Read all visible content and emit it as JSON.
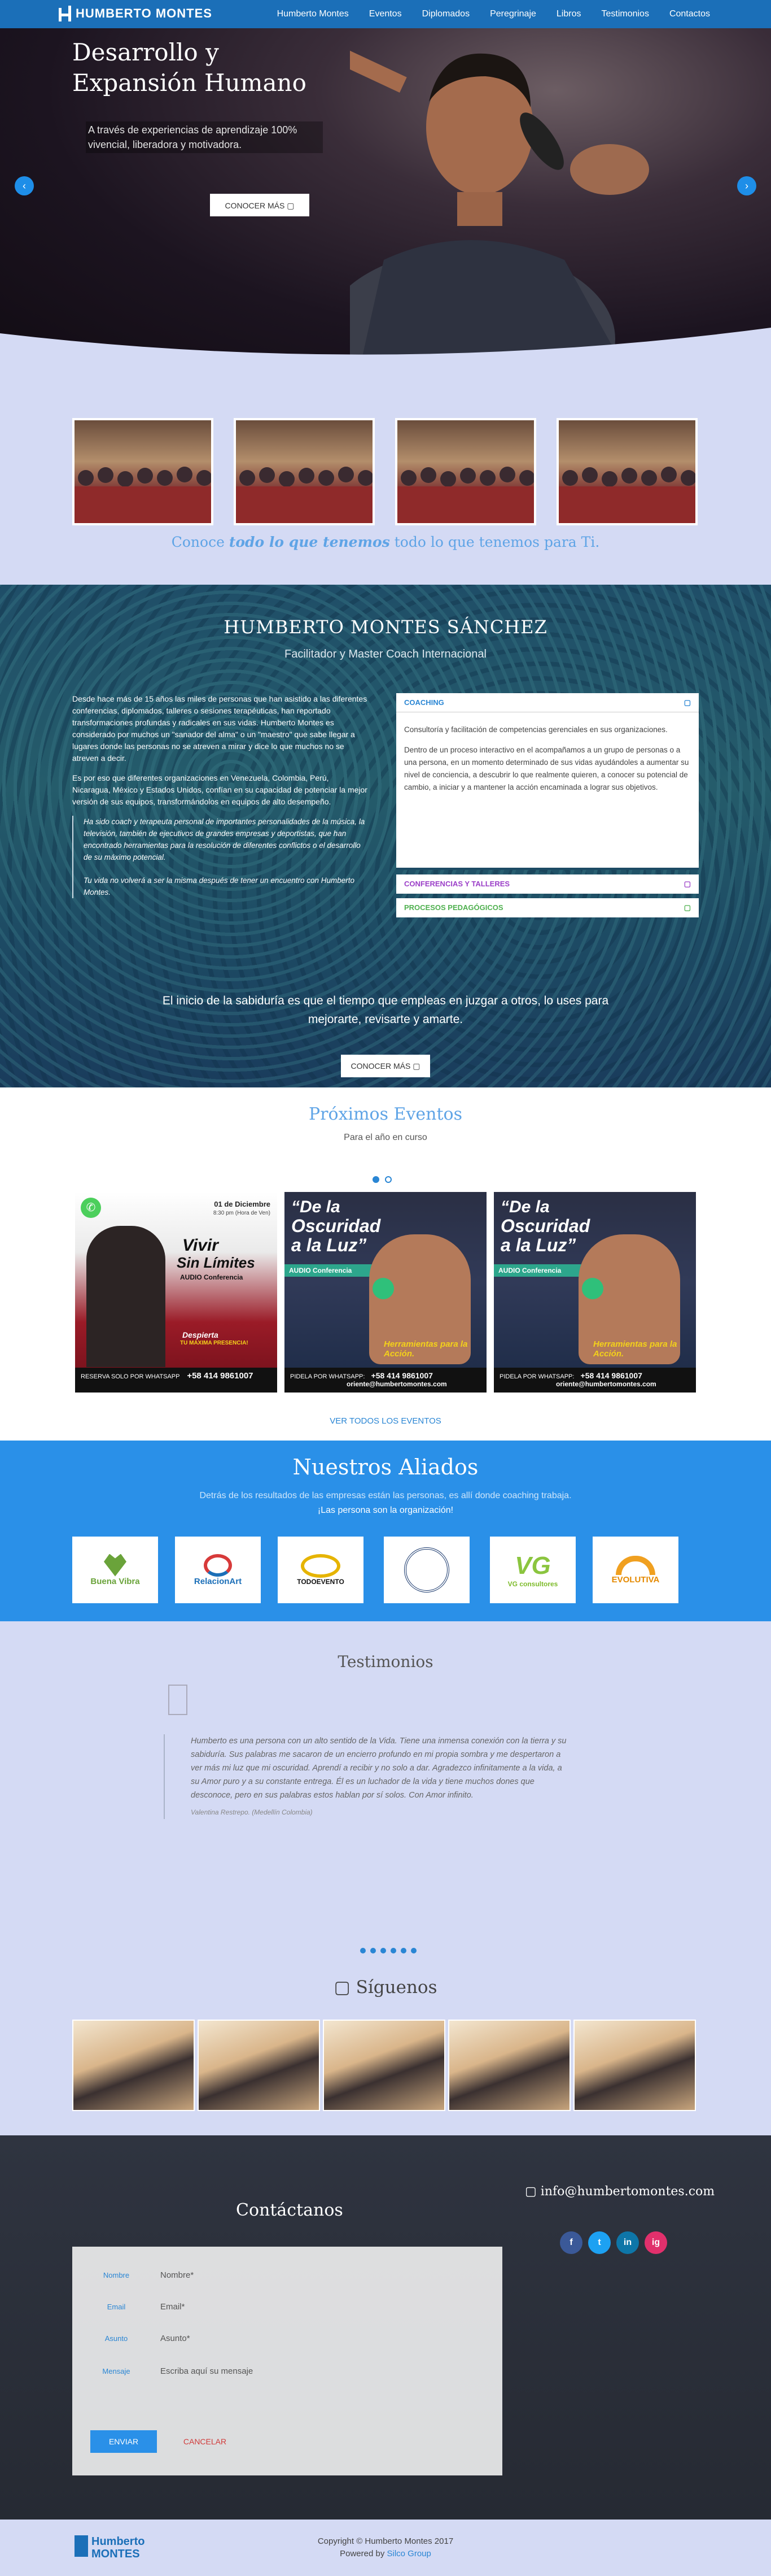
{
  "brand": {
    "name": "HUMBERTO MONTES",
    "footer_line1": "Humberto",
    "footer_line2": "MONTES"
  },
  "nav": [
    "Humberto Montes",
    "Eventos",
    "Diplomados",
    "Peregrinaje",
    "Libros",
    "Testimonios",
    "Contactos"
  ],
  "hero": {
    "title_line1": "Desarrollo y",
    "title_line2": "Expansión Humano",
    "subtitle": "A través de experiencias de aprendizaje 100% vivencial, liberadora y motivadora.",
    "cta": "CONOCER MÁS",
    "prev_icon": "‹",
    "next_icon": "›"
  },
  "gallery": {
    "caption_pre": "Conoce ",
    "caption_em": "todo lo que tenemos",
    "caption_post": " todo lo que tenemos para Ti."
  },
  "about": {
    "title": "HUMBERTO MONTES SÁNCHEZ",
    "subtitle": "Facilitador y Master Coach Internacional",
    "p1": "Desde hace más de 15 años las miles de personas que han asistido a las diferentes conferencias, diplomados, talleres o sesiones terapéuticas, han reportado transformaciones profundas y radicales en sus vidas. Humberto Montes es considerado por muchos un \"sanador del alma\" o un \"maestro\" que sabe llegar a lugares donde las personas no se atreven a mirar y dice lo que muchos no se atreven a decir.",
    "p2": "Es por eso que diferentes organizaciones en Venezuela, Colombia, Perú, Nicaragua, México y Estados Unidos, confían en su capacidad de potenciar la mejor versión de sus equipos, transformándolos en equipos de alto desempeño.",
    "q1": "Ha sido coach y terapeuta personal de importantes personalidades de la música, la televisión, también de ejecutivos de grandes empresas y deportistas, que han encontrado herramientas para la resolución de diferentes conflictos o el desarrollo de su máximo potencial.",
    "q2": "Tu vida no volverá a ser la misma después de tener un encuentro con Humberto Montes.",
    "accordion": {
      "coaching": "COACHING",
      "coaching_p1": "Consultoría y facilitación de competencias gerenciales en sus organizaciones.",
      "coaching_p2": "Dentro de un proceso interactivo en el acompañamos a un grupo de personas o a una persona, en un momento determinado de sus vidas ayudándoles a aumentar su nivel de conciencia, a descubrir lo que realmente quieren, a conocer su potencial de cambio, a iniciar y a mantener la acción encaminada a lograr sus objetivos.",
      "conferencias": "CONFERENCIAS Y TALLERES",
      "procesos": "PROCESOS PEDAGÓGICOS",
      "toggle_icon": "▢"
    },
    "quote_line1": "El inicio de la sabiduría es que el tiempo que empleas en juzgar a otros, lo uses para",
    "quote_line2": "mejorarte, revisarte y amarte.",
    "cta": "CONOCER MÁS"
  },
  "events": {
    "title": "Próximos Eventos",
    "subtitle": "Para el año en curso",
    "link": "VER TODOS LOS EVENTOS",
    "poster1": {
      "date": "01 de Diciembre",
      "time": "8:30 pm (Hora de Ven)",
      "title1": "Vivir",
      "title2": "Sin Límites",
      "tag": "AUDIO Conferencia",
      "slogan1": "Despierta",
      "slogan2": "TU MÁXIMA PRESENCIA!",
      "phone": "+58 414 9861007",
      "strip": "RESERVA SOLO POR WHATSAPP"
    },
    "poster2": {
      "title1": "“De la",
      "title2": "Oscuridad",
      "title3": "a la Luz”",
      "tag": "AUDIO Conferencia",
      "yellow": "Herramientas para la Acción.",
      "phone": "+58 414 9861007",
      "email": "oriente@humbertomontes.com",
      "strip": "PIDELA POR WHATSAPP:"
    }
  },
  "allies": {
    "title": "Nuestros Aliados",
    "sub1": "Detrás de los resultados de las empresas están las personas, es allí donde coaching trabaja.",
    "sub2": "¡Las persona son la organización!",
    "logos": [
      "Buena Vibra",
      "RelacionArt",
      "TODOEVENTO",
      "Seal",
      "VG consultores",
      "EVOLUTIVA"
    ]
  },
  "testimonios": {
    "title": "Testimonios",
    "text": "Humberto es una persona con un alto sentido de la Vida. Tiene una inmensa conexión con la tierra y su sabiduría. Sus palabras me sacaron de un encierro profundo en mi propia sombra y me despertaron a ver más mi luz que mi oscuridad. Aprendí a recibir y no solo a dar. Agradezco infinitamente a la vida, a su Amor puro y a su constante entrega. Él es un luchador de la vida y tiene muchos dones que desconoce, pero en sus palabras estos hablan por sí solos. Con Amor infinito.",
    "author": "Valentina Restrepo. (Medellín Colombia)",
    "follow": "Síguenos",
    "follow_icon": "▢"
  },
  "contact": {
    "title": "Contáctanos",
    "email": "info@humbertomontes.com",
    "email_icon": "▢",
    "fields": [
      {
        "label": "Nombre",
        "placeholder": "Nombre*"
      },
      {
        "label": "Email",
        "placeholder": "Email*"
      },
      {
        "label": "Asunto",
        "placeholder": "Asunto*"
      },
      {
        "label": "Mensaje",
        "placeholder": "Escriba aquí su mensaje"
      }
    ],
    "send": "ENVIAR",
    "cancel": "CANCELAR",
    "socials": [
      "f",
      "t",
      "in",
      "ig"
    ],
    "social_colors": [
      "#3b5998",
      "#1da1f2",
      "#0e76a8",
      "#e1306c"
    ]
  },
  "footer": {
    "copyright": "Copyright © Humberto Montes 2017",
    "powered_pre": "Powered by ",
    "powered_link": "Silco Group"
  }
}
